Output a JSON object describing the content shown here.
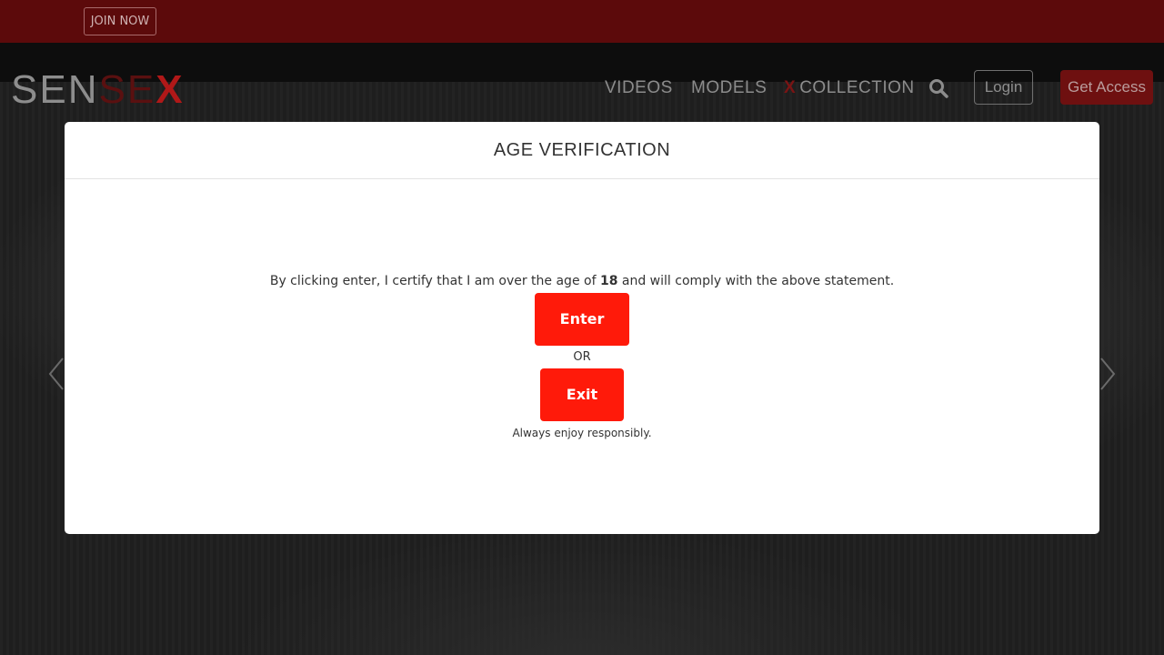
{
  "topbar": {
    "join_label": "JOIN NOW"
  },
  "header": {
    "logo": {
      "part1": "SEN",
      "part2": "SE",
      "part3": "X"
    },
    "nav": {
      "videos": "VIDEOS",
      "models": "MODELS",
      "collection_mark": "X",
      "collection": "COLLECTION"
    },
    "login_label": "Login",
    "access_label": "Get Access"
  },
  "icons": {
    "search": "search-icon",
    "prev": "chevron-left-icon",
    "next": "chevron-right-icon"
  },
  "modal": {
    "title": "AGE VERIFICATION",
    "statement_before": "By clicking enter, I certify that I am over the age of ",
    "statement_age": "18",
    "statement_after": " and will comply with the above statement.",
    "enter_label": "Enter",
    "or_label": "OR",
    "exit_label": "Exit",
    "note": "Always enjoy responsibly."
  },
  "colors": {
    "topbar": "#5c0a0b",
    "accent": "#ff1a0a",
    "modal_bg": "#ffffff"
  }
}
